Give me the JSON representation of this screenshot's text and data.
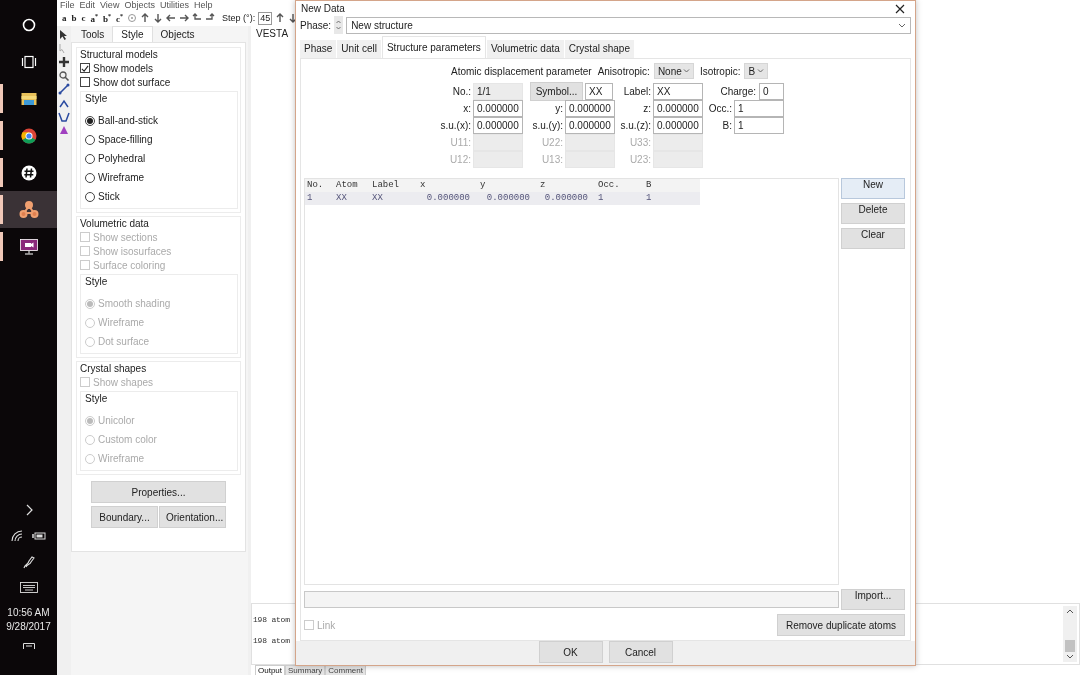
{
  "taskbar": {
    "apps": [
      {
        "kind": "ring",
        "running": false,
        "selected": false
      },
      {
        "kind": "task-view",
        "running": false,
        "selected": false
      },
      {
        "kind": "folder",
        "running": true,
        "selected": false
      },
      {
        "kind": "browser",
        "running": true,
        "selected": false
      },
      {
        "kind": "hash",
        "running": true,
        "selected": false
      },
      {
        "kind": "molecule",
        "running": true,
        "selected": true
      },
      {
        "kind": "monitor",
        "running": true,
        "selected": false
      }
    ],
    "clock": {
      "time": "10:56 AM",
      "date": "9/28/2017"
    }
  },
  "menu": [
    "File",
    "Edit",
    "View",
    "Objects",
    "Utilities",
    "Help"
  ],
  "toolbar": {
    "axes": [
      "a",
      "b",
      "c",
      "a$^{*}$",
      "b$^{*}$",
      "c$^{*}$"
    ],
    "step_label": "Step (°):",
    "step_value": "45"
  },
  "side_panel": {
    "tabs": [
      {
        "label": "Tools",
        "selected": false
      },
      {
        "label": "Style",
        "selected": true
      },
      {
        "label": "Objects",
        "selected": false
      }
    ],
    "groups": [
      {
        "title": "Structural models",
        "checkboxes": [
          {
            "label": "Show models",
            "checked": true,
            "disabled": false
          },
          {
            "label": "Show dot surface",
            "checked": false,
            "disabled": false
          }
        ],
        "style": {
          "title": "Style",
          "options": [
            {
              "label": "Ball-and-stick",
              "selected": true,
              "disabled": false
            },
            {
              "label": "Space-filling",
              "selected": false,
              "disabled": false
            },
            {
              "label": "Polyhedral",
              "selected": false,
              "disabled": false
            },
            {
              "label": "Wireframe",
              "selected": false,
              "disabled": false
            },
            {
              "label": "Stick",
              "selected": false,
              "disabled": false
            }
          ]
        }
      },
      {
        "title": "Volumetric data",
        "checkboxes": [
          {
            "label": "Show sections",
            "checked": false,
            "disabled": true
          },
          {
            "label": "Show isosurfaces",
            "checked": false,
            "disabled": true
          },
          {
            "label": "Surface coloring",
            "checked": false,
            "disabled": true
          }
        ],
        "style": {
          "title": "Style",
          "options": [
            {
              "label": "Smooth shading",
              "selected": true,
              "disabled": true
            },
            {
              "label": "Wireframe",
              "selected": false,
              "disabled": true
            },
            {
              "label": "Dot surface",
              "selected": false,
              "disabled": true
            }
          ]
        }
      },
      {
        "title": "Crystal shapes",
        "checkboxes": [
          {
            "label": "Show shapes",
            "checked": false,
            "disabled": true
          }
        ],
        "style": {
          "title": "Style",
          "options": [
            {
              "label": "Unicolor",
              "selected": true,
              "disabled": true
            },
            {
              "label": "Custom color",
              "selected": false,
              "disabled": true
            },
            {
              "label": "Wireframe",
              "selected": false,
              "disabled": true
            }
          ]
        }
      }
    ],
    "buttons": [
      "Properties...",
      "Boundary...",
      "Orientation..."
    ]
  },
  "viewer": {
    "tab": "VESTA"
  },
  "output": {
    "lines": [
      "198 atom",
      "198 atom"
    ],
    "tabs": [
      {
        "label": "Output",
        "selected": true
      },
      {
        "label": "Summary",
        "selected": false
      },
      {
        "label": "Comment",
        "selected": false
      }
    ]
  },
  "dialog": {
    "title": "New Data",
    "phase_label": "Phase:",
    "phase_value": "New structure",
    "tabs": [
      {
        "label": "Phase",
        "selected": false
      },
      {
        "label": "Unit cell",
        "selected": false
      },
      {
        "label": "Structure parameters",
        "selected": true
      },
      {
        "label": "Volumetric data",
        "selected": false
      },
      {
        "label": "Crystal shape",
        "selected": false
      }
    ],
    "adp": {
      "title": "Atomic displacement parameter",
      "aniso_label": "Anisotropic:",
      "aniso_value": "None",
      "iso_label": "Isotropic:",
      "iso_value": "B"
    },
    "atom": {
      "no_label": "No.:",
      "no_value": "1/1",
      "symbol_button": "Symbol...",
      "symbol_value": "XX",
      "label_label": "Label:",
      "label_value": "XX",
      "charge_label": "Charge:",
      "charge_value": "0"
    },
    "rows": [
      [
        {
          "label": "x:",
          "value": "0.000000",
          "disabled": false
        },
        {
          "label": "y:",
          "value": "0.000000",
          "disabled": false
        },
        {
          "label": "z:",
          "value": "0.000000",
          "disabled": false
        },
        {
          "label": "Occ.:",
          "value": "1",
          "disabled": false
        }
      ],
      [
        {
          "label": "s.u.(x):",
          "value": "0.000000",
          "disabled": false
        },
        {
          "label": "s.u.(y):",
          "value": "0.000000",
          "disabled": false
        },
        {
          "label": "s.u.(z):",
          "value": "0.000000",
          "disabled": false
        },
        {
          "label": "B:",
          "value": "1",
          "disabled": false
        }
      ],
      [
        {
          "label": "U11:",
          "disabled": true
        },
        {
          "label": "U22:",
          "disabled": true
        },
        {
          "label": "U33:",
          "disabled": true
        }
      ],
      [
        {
          "label": "U12:",
          "disabled": true
        },
        {
          "label": "U13:",
          "disabled": true
        },
        {
          "label": "U23:",
          "disabled": true
        }
      ]
    ],
    "table": {
      "columns": [
        "No.",
        "Atom",
        "Label",
        "x",
        "y",
        "z",
        "Occ.",
        "B"
      ],
      "rows": [
        {
          "cells": [
            "1",
            "XX",
            "XX",
            "0.000000",
            "0.000000",
            "0.000000",
            "1",
            "1"
          ],
          "selected": true
        }
      ]
    },
    "side_buttons": [
      {
        "label": "New",
        "focused": true
      },
      {
        "label": "Delete",
        "focused": false
      },
      {
        "label": "Clear",
        "focused": false
      }
    ],
    "import_button": "Import...",
    "link": {
      "label": "Link",
      "checked": false,
      "disabled": true
    },
    "remove_button": "Remove duplicate atoms",
    "ok_button": "OK",
    "cancel_button": "Cancel"
  }
}
